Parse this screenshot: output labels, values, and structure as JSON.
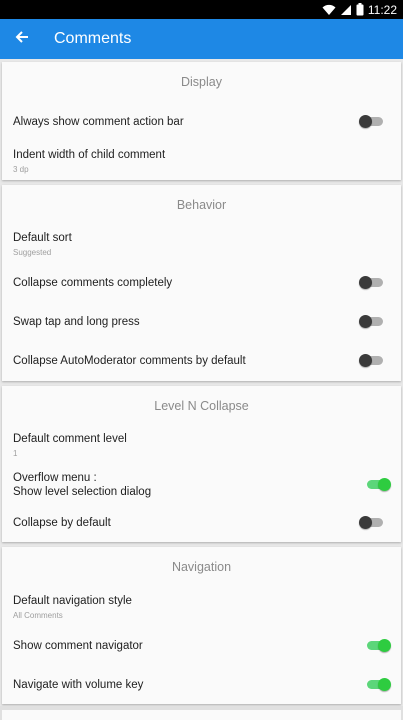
{
  "status": {
    "time": "11:22"
  },
  "appbar": {
    "title": "Comments"
  },
  "sections": [
    {
      "header": "Display",
      "rows": [
        {
          "title": "Always show comment action bar",
          "toggle": false
        },
        {
          "title": "Indent width of child comment",
          "subtitle": "3 dp"
        }
      ]
    },
    {
      "header": "Behavior",
      "rows": [
        {
          "title": "Default sort",
          "subtitle": "Suggested"
        },
        {
          "title": "Collapse comments completely",
          "toggle": false
        },
        {
          "title": "Swap tap and long press",
          "toggle": false
        },
        {
          "title": "Collapse AutoModerator comments by default",
          "toggle": false
        }
      ]
    },
    {
      "header": "Level N Collapse",
      "rows": [
        {
          "title": "Default comment level",
          "subtitle": "1"
        },
        {
          "title_line1": "Overflow menu :",
          "title_line2": "Show level selection dialog",
          "toggle": true
        },
        {
          "title": "Collapse by default",
          "toggle": false
        }
      ]
    },
    {
      "header": "Navigation",
      "rows": [
        {
          "title": "Default navigation style",
          "subtitle": "All Comments"
        },
        {
          "title": "Show comment navigator",
          "toggle": true
        },
        {
          "title": "Navigate with volume key",
          "toggle": true
        }
      ]
    }
  ],
  "colors": {
    "appbar": "#1e88e5",
    "toggle_on": "#2ecc40",
    "toggle_off": "#3a3a3a"
  }
}
